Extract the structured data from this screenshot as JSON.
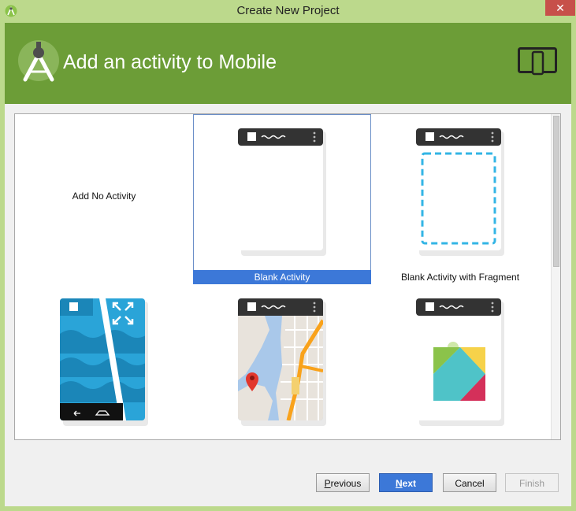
{
  "window": {
    "title": "Create New Project",
    "close_glyph": "✕"
  },
  "header": {
    "title": "Add an activity to Mobile"
  },
  "templates": [
    {
      "label": "Add No Activity"
    },
    {
      "label": "Blank Activity"
    },
    {
      "label": "Blank Activity with Fragment"
    },
    {
      "label": ""
    },
    {
      "label": ""
    },
    {
      "label": ""
    }
  ],
  "buttons": {
    "previous": {
      "access_key": "P",
      "rest": "revious"
    },
    "next": {
      "access_key": "N",
      "rest": "ext"
    },
    "cancel": "Cancel",
    "finish": "Finish"
  },
  "colors": {
    "header_green": "#6c9d37",
    "selection_blue": "#3c78d8",
    "fragment_dash": "#33b5e5"
  },
  "icons": [
    "android-studio-logo",
    "device-form-factor-icon",
    "close-icon"
  ]
}
